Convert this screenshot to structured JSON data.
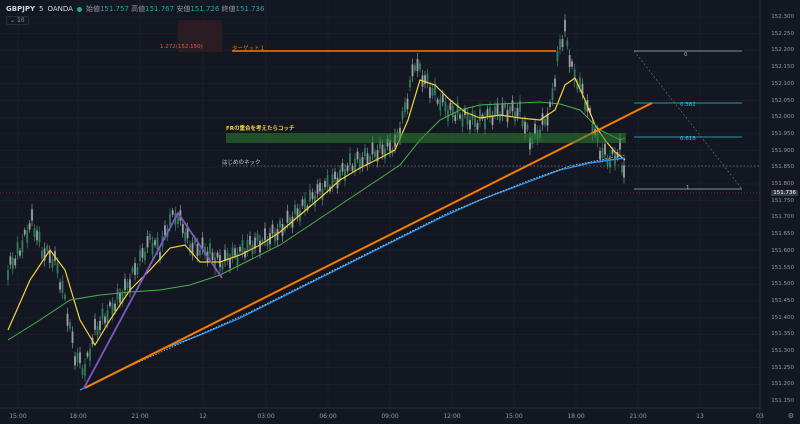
{
  "header": {
    "symbol": "GBPJPY",
    "interval": "5",
    "source": "OANDA",
    "open_label": "始値",
    "open": "151.757",
    "high_label": "高値",
    "high": "151.767",
    "low_label": "安値",
    "low": "151.726",
    "close_label": "終値",
    "close": "151.736",
    "indicator_count": "10"
  },
  "colors": {
    "background": "#131722",
    "up": "#26a69a",
    "down": "#ef5350",
    "ma_fast": "#f5d33a",
    "ma_mid": "#4caf50",
    "ma_slow": "#2196f3",
    "trendline": "#f57c00",
    "abc_wave": "#7e57c2",
    "zone": "#2e7d32"
  },
  "x_axis": [
    "15:00",
    "18:00",
    "21:00",
    "12",
    "03:00",
    "06:00",
    "09:00",
    "12:00",
    "15:00",
    "18:00",
    "21:00",
    "13",
    "03"
  ],
  "y_axis": [
    "152.300",
    "152.250",
    "152.200",
    "152.150",
    "152.100",
    "152.050",
    "152.000",
    "151.950",
    "151.900",
    "151.850",
    "151.800",
    "151.750",
    "151.700",
    "151.650",
    "151.600",
    "151.550",
    "151.500",
    "151.450",
    "151.400",
    "151.350",
    "151.300",
    "151.250",
    "151.200",
    "151.150"
  ],
  "last_price": "151.736",
  "annotations": {
    "target": "1.272(152.150)",
    "target_label": "ターゲット１",
    "zone_label": "FRの重合を考えたらコッチ",
    "neckline_label": "はじめのネック"
  },
  "fib": {
    "level_0": "0",
    "level_382": "0.382",
    "level_618": "0.618",
    "level_1": "1"
  }
}
